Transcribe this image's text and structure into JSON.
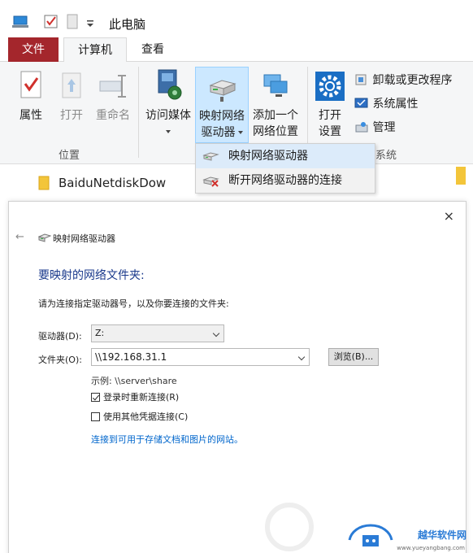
{
  "window": {
    "title": "此电脑"
  },
  "ribbon": {
    "tabs": [
      {
        "label": "文件"
      },
      {
        "label": "计算机"
      },
      {
        "label": "查看"
      }
    ],
    "location_group": {
      "label": "位置",
      "properties": "属性",
      "open": "打开",
      "rename": "重命名"
    },
    "network_group": {
      "access_media": "访问媒体",
      "map_drive_line1": "映射网络",
      "map_drive_line2": "驱动器",
      "add_location_line1": "添加一个",
      "add_location_line2": "网络位置"
    },
    "system_group": {
      "label": "系统",
      "open_settings_line1": "打开",
      "open_settings_line2": "设置",
      "uninstall": "卸载或更改程序",
      "system_properties": "系统属性",
      "manage": "管理"
    }
  },
  "dropdown": {
    "items": [
      {
        "label": "映射网络驱动器"
      },
      {
        "label": "断开网络驱动器的连接"
      }
    ]
  },
  "explorer": {
    "row_label": "BaiduNetdiskDow"
  },
  "dialog": {
    "title": "映射网络驱动器",
    "close": "×",
    "back": "←",
    "heading": "要映射的网络文件夹:",
    "description": "请为连接指定驱动器号，以及你要连接的文件夹:",
    "drive_label": "驱动器(D):",
    "drive_value": "Z:",
    "folder_label": "文件夹(O):",
    "folder_value": "\\\\192.168.31.1",
    "browse": "浏览(B)...",
    "example": "示例: \\\\server\\share",
    "reconnect": {
      "label": "登录时重新连接(R)",
      "checked": true
    },
    "other_credentials": {
      "label": "使用其他凭据连接(C)",
      "checked": false
    },
    "link": "连接到可用于存储文档和图片的网站。"
  },
  "watermark": {
    "text": "越华软件网",
    "url": "www.yueyangbang.com"
  },
  "colors": {
    "file_tab": "#a4262c",
    "selected": "#cce8ff",
    "heading": "#1b3a8c",
    "link": "#0066cc"
  }
}
